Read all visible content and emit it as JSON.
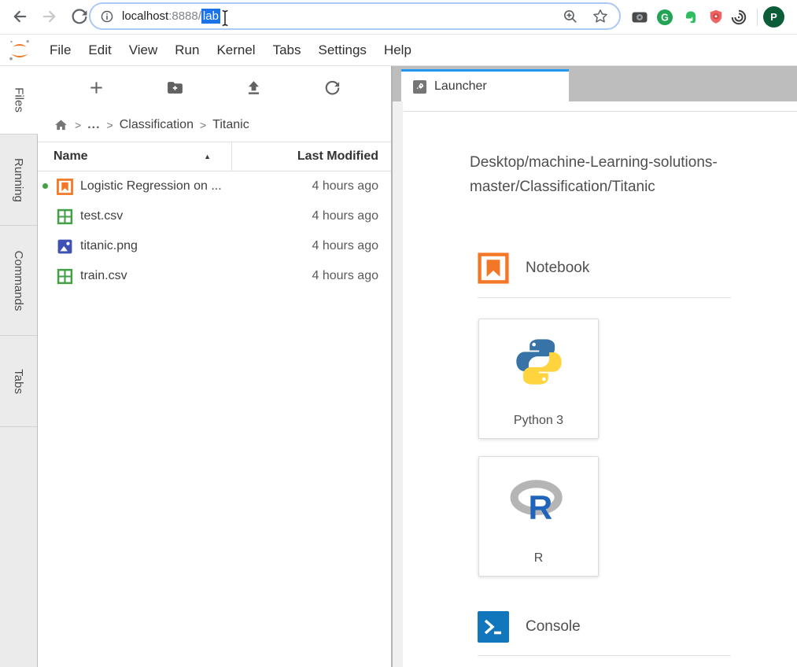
{
  "browser": {
    "url": {
      "host": "localhost",
      "port": ":8888/",
      "selected": "lab"
    },
    "profile_initial": "P"
  },
  "menu": {
    "items": [
      "File",
      "Edit",
      "View",
      "Run",
      "Kernel",
      "Tabs",
      "Settings",
      "Help"
    ]
  },
  "sidebar": {
    "tabs": [
      {
        "label": "Files",
        "active": true
      },
      {
        "label": "Running",
        "active": false
      },
      {
        "label": "Commands",
        "active": false
      },
      {
        "label": "Tabs",
        "active": false
      }
    ]
  },
  "file_browser": {
    "breadcrumb": {
      "separator": ">",
      "ellipsis": "..."
    },
    "crumbs": [
      "Classification",
      "Titanic"
    ],
    "header": {
      "name": "Name",
      "modified": "Last Modified",
      "sort_caret": "▲"
    },
    "files": [
      {
        "name": "Logistic Regression on ...",
        "modified": "4 hours ago",
        "type": "notebook",
        "running": true
      },
      {
        "name": "test.csv",
        "modified": "4 hours ago",
        "type": "csv",
        "running": false
      },
      {
        "name": "titanic.png",
        "modified": "4 hours ago",
        "type": "image",
        "running": false
      },
      {
        "name": "train.csv",
        "modified": "4 hours ago",
        "type": "csv",
        "running": false
      }
    ]
  },
  "main": {
    "tab_label": "Launcher",
    "launcher": {
      "current_path": "Desktop/machine-Learning-solutions-master/Classification/Titanic",
      "notebook_section": {
        "label": "Notebook",
        "cards": [
          {
            "label": "Python 3"
          },
          {
            "label": "R"
          }
        ]
      },
      "console_section": {
        "label": "Console"
      }
    }
  },
  "colors": {
    "selection_blue": "#1a73e8",
    "active_tab_blue": "#2196f3",
    "jupyter_orange": "#f37726",
    "running_green": "#43a047",
    "csv_green": "#43a047",
    "image_blue": "#3f51b5",
    "console_blue": "#1276bc",
    "python_blue": "#3873a8",
    "python_yellow": "#ffd43e",
    "r_blue": "#2065ba",
    "avatar_green": "#0d5c38",
    "tabbar_gray": "#bdbdbd"
  }
}
